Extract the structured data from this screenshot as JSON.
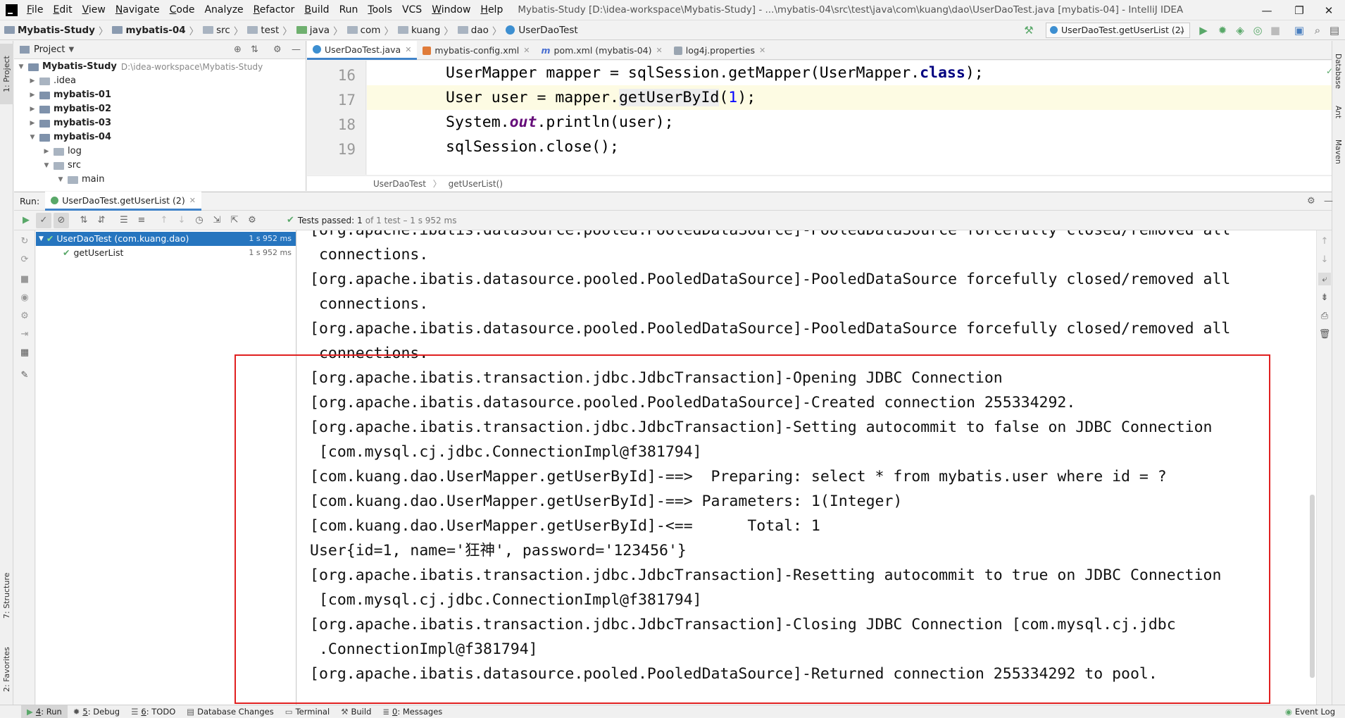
{
  "window": {
    "title": "Mybatis-Study [D:\\idea-workspace\\Mybatis-Study] - ...\\mybatis-04\\src\\test\\java\\com\\kuang\\dao\\UserDaoTest.java [mybatis-04] - IntelliJ IDEA",
    "controls": [
      "—",
      "❐",
      "✕"
    ]
  },
  "menu": [
    {
      "u": "F",
      "rest": "ile"
    },
    {
      "u": "E",
      "rest": "dit"
    },
    {
      "u": "V",
      "rest": "iew"
    },
    {
      "u": "N",
      "rest": "avigate"
    },
    {
      "u": "C",
      "rest": "ode"
    },
    {
      "u": "",
      "rest": "Analyze"
    },
    {
      "u": "R",
      "rest": "efactor"
    },
    {
      "u": "B",
      "rest": "uild"
    },
    {
      "u": "",
      "rest": "Run"
    },
    {
      "u": "T",
      "rest": "ools"
    },
    {
      "u": "",
      "rest": "VCS"
    },
    {
      "u": "W",
      "rest": "indow"
    },
    {
      "u": "H",
      "rest": "elp"
    }
  ],
  "breadcrumb": [
    "Mybatis-Study",
    "mybatis-04",
    "src",
    "test",
    "java",
    "com",
    "kuang",
    "dao",
    "UserDaoTest"
  ],
  "run_config": "UserDaoTest.getUserList (2)",
  "left_strip": {
    "project": "1: Project",
    "structure": "7: Structure",
    "favorites": "2: Favorites"
  },
  "right_strip": {
    "database": "Database",
    "ant": "Ant",
    "maven": "Maven"
  },
  "project_panel": {
    "title": "Project",
    "tree": [
      {
        "label": "Mybatis-Study",
        "path": "D:\\idea-workspace\\Mybatis-Study"
      },
      {
        "label": ".idea"
      },
      {
        "label": "mybatis-01"
      },
      {
        "label": "mybatis-02"
      },
      {
        "label": "mybatis-03"
      },
      {
        "label": "mybatis-04"
      },
      {
        "label": "log"
      },
      {
        "label": "src"
      },
      {
        "label": "main"
      }
    ]
  },
  "editor": {
    "tabs": [
      "UserDaoTest.java",
      "mybatis-config.xml",
      "pom.xml (mybatis-04)",
      "log4j.properties"
    ],
    "lines": [
      "16",
      "17",
      "18",
      "19"
    ],
    "breadcrumb": [
      "UserDaoTest",
      "getUserList()"
    ]
  },
  "run_panel": {
    "label": "Run:",
    "tab": "UserDaoTest.getUserList (2)",
    "tests_passed": "Tests passed:",
    "tests_count": "1",
    "tests_detail": "of 1 test – 1 s 952 ms",
    "tree": [
      {
        "label": "UserDaoTest (com.kuang.dao)",
        "time": "1 s 952 ms"
      },
      {
        "label": "getUserList",
        "time": "1 s 952 ms"
      }
    ]
  },
  "console": [
    "[org.apache.ibatis.datasource.pooled.PooledDataSource]-PooledDataSource forcefully closed/removed all",
    " connections.",
    "[org.apache.ibatis.datasource.pooled.PooledDataSource]-PooledDataSource forcefully closed/removed all",
    " connections.",
    "[org.apache.ibatis.datasource.pooled.PooledDataSource]-PooledDataSource forcefully closed/removed all",
    " connections.",
    "[org.apache.ibatis.transaction.jdbc.JdbcTransaction]-Opening JDBC Connection",
    "[org.apache.ibatis.datasource.pooled.PooledDataSource]-Created connection 255334292.",
    "[org.apache.ibatis.transaction.jdbc.JdbcTransaction]-Setting autocommit to false on JDBC Connection",
    " [com.mysql.cj.jdbc.ConnectionImpl@f381794]",
    "[com.kuang.dao.UserMapper.getUserById]-==>  Preparing: select * from mybatis.user where id = ?",
    "[com.kuang.dao.UserMapper.getUserById]-==> Parameters: 1(Integer)",
    "[com.kuang.dao.UserMapper.getUserById]-<==      Total: 1",
    "User{id=1, name='狂神', password='123456'}",
    "[org.apache.ibatis.transaction.jdbc.JdbcTransaction]-Resetting autocommit to true on JDBC Connection",
    " [com.mysql.cj.jdbc.ConnectionImpl@f381794]",
    "[org.apache.ibatis.transaction.jdbc.JdbcTransaction]-Closing JDBC Connection [com.mysql.cj.jdbc",
    " .ConnectionImpl@f381794]",
    "[org.apache.ibatis.datasource.pooled.PooledDataSource]-Returned connection 255334292 to pool."
  ],
  "status_tabs": [
    {
      "u": "4",
      "rest": ": Run"
    },
    {
      "u": "5",
      "rest": ": Debug"
    },
    {
      "u": "6",
      "rest": ": TODO"
    },
    {
      "u": "",
      "rest": "Database Changes"
    },
    {
      "u": "",
      "rest": "Terminal"
    },
    {
      "u": "",
      "rest": "Build"
    },
    {
      "u": "0",
      "rest": ": Messages"
    }
  ],
  "event_log": "Event Log",
  "colors": {
    "accent": "#4083c9",
    "selection": "#2675bf",
    "highlight_box": "#e02020",
    "pass_green": "#59a869"
  }
}
